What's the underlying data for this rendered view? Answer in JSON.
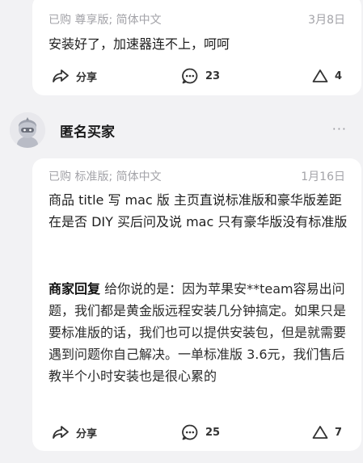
{
  "reviews": [
    {
      "meta": "已购 尊享版; 简体中文",
      "date": "3月8日",
      "text": "安装好了，加速器连不上，呵呵",
      "share_label": "分享",
      "comment_count": "23",
      "like_count": "4"
    },
    {
      "username": "匿名买家",
      "more_label": "···",
      "meta": "已购 标准版; 简体中文",
      "date": "1月16日",
      "text": "商品 title 写 mac 版 主页直说标准版和豪华版差距在是否 DIY 买后问及说 mac 只有豪华版没有标准版",
      "reply_label": "商家回复",
      "reply_text": "给你说的是：因为苹果安**team容易出问题，我们都是黄金版远程安装几分钟搞定。如果只是要标准版的话，我们也可以提供安装包，但是就需要遇到问题你自己解决。一单标准版 3.6元，我们售后教半个小时安装也是很心累的",
      "share_label": "分享",
      "comment_count": "25",
      "like_count": "7"
    }
  ],
  "icons": {
    "share": "share-arrow-icon",
    "comment": "comment-bubble-icon",
    "like": "triangle-like-icon",
    "avatar": "anonymous-avatar-icon"
  }
}
